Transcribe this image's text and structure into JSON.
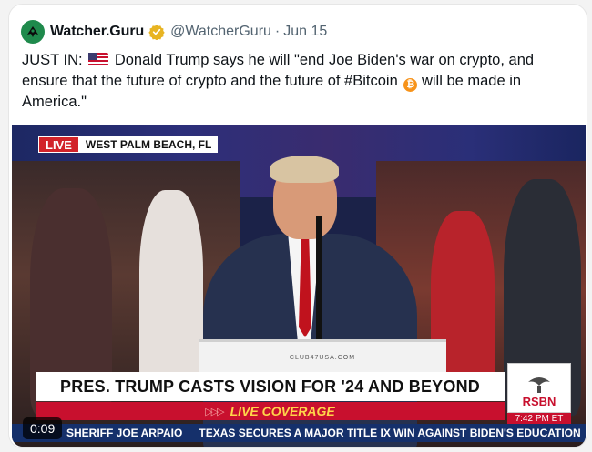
{
  "tweet": {
    "author_name": "Watcher.Guru",
    "handle": "@WatcherGuru",
    "separator": "·",
    "date": "Jun 15",
    "text_prefix": "JUST IN:",
    "text_body": "Donald Trump says he will \"end Joe Biden's war on crypto, and ensure that the future of crypto and the future of #Bitcoin",
    "text_suffix": "will be made in America.\"",
    "icons": {
      "avatar": "watcher-guru-logo-icon",
      "verified": "gold-verified-badge-icon",
      "flag": "us-flag-icon",
      "bitcoin": "bitcoin-icon"
    }
  },
  "video": {
    "live_label": "LIVE",
    "location": "WEST PALM BEACH, FL",
    "headline": "PRES. TRUMP CASTS VISION FOR '24 AND BEYOND",
    "subheadline": "LIVE COVERAGE",
    "network": "RSBN",
    "network_time": "7:42 PM ET",
    "ticker_items": [
      "SHERIFF JOE ARPAIO",
      "TEXAS SECURES A MAJOR TITLE IX WIN AGAINST BIDEN'S EDUCATION"
    ],
    "timestamp": "0:09",
    "podium_text": "CLUB47USA.COM"
  },
  "colors": {
    "verified_gold": "#e8b422",
    "live_red": "#d2232a",
    "handle_gray": "#536471",
    "ticker_blue": "#15306b",
    "bitcoin_orange": "#f7931a"
  }
}
